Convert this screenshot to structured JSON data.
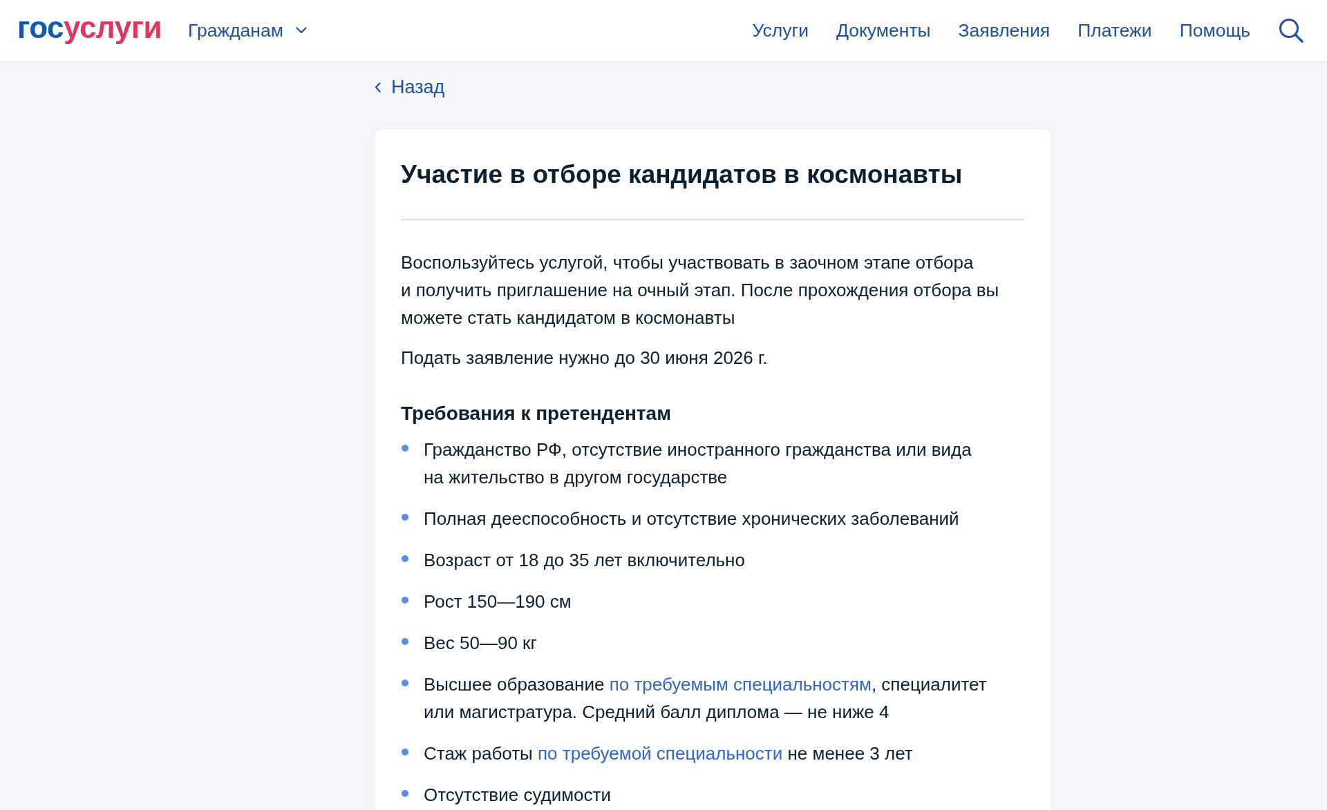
{
  "header": {
    "logo": {
      "parts": [
        {
          "text": "гос",
          "color": "#0f5aa8"
        },
        {
          "text": "услуги",
          "color": "#e2375c"
        }
      ]
    },
    "audience_menu": {
      "label": "Гражданам",
      "expanded": false
    },
    "nav": [
      {
        "label": "Услуги"
      },
      {
        "label": "Документы"
      },
      {
        "label": "Заявления"
      },
      {
        "label": "Платежи"
      },
      {
        "label": "Помощь"
      }
    ]
  },
  "back_link": {
    "label": "Назад"
  },
  "card": {
    "title": "Участие в отборе кандидатов в космонавты",
    "intro": "Воспользуйтесь услугой, чтобы участвовать в заочном этапе отбора и получить приглашение на очный этап. После прохождения отбора вы можете стать кандидатом в космонавты",
    "deadline": "Подать заявление нужно до 30 июня 2026 г.",
    "requirements": {
      "heading": "Требования к претендентам",
      "items": [
        {
          "parts": [
            {
              "kind": "text",
              "text": "Гражданство РФ, отсутствие иностранного гражданства или вида на жительство в другом государстве"
            }
          ]
        },
        {
          "parts": [
            {
              "kind": "text",
              "text": "Полная дееспособность и отсутствие хронических заболеваний"
            }
          ]
        },
        {
          "parts": [
            {
              "kind": "text",
              "text": "Возраст от 18 до 35 лет включительно"
            }
          ]
        },
        {
          "parts": [
            {
              "kind": "text",
              "text": "Рост 150—190 см"
            }
          ]
        },
        {
          "parts": [
            {
              "kind": "text",
              "text": "Вес 50—90 кг"
            }
          ]
        },
        {
          "parts": [
            {
              "kind": "text",
              "text": "Высшее образование "
            },
            {
              "kind": "link",
              "text": "по требуемым специальностям"
            },
            {
              "kind": "text",
              "text": ", специалитет или магистратура. Средний балл диплома — не ниже 4"
            }
          ]
        },
        {
          "parts": [
            {
              "kind": "text",
              "text": "Стаж работы "
            },
            {
              "kind": "link",
              "text": "по требуемой специальности"
            },
            {
              "kind": "text",
              "text": " не менее 3 лет"
            }
          ]
        },
        {
          "parts": [
            {
              "kind": "text",
              "text": "Отсутствие судимости"
            }
          ]
        }
      ]
    }
  }
}
